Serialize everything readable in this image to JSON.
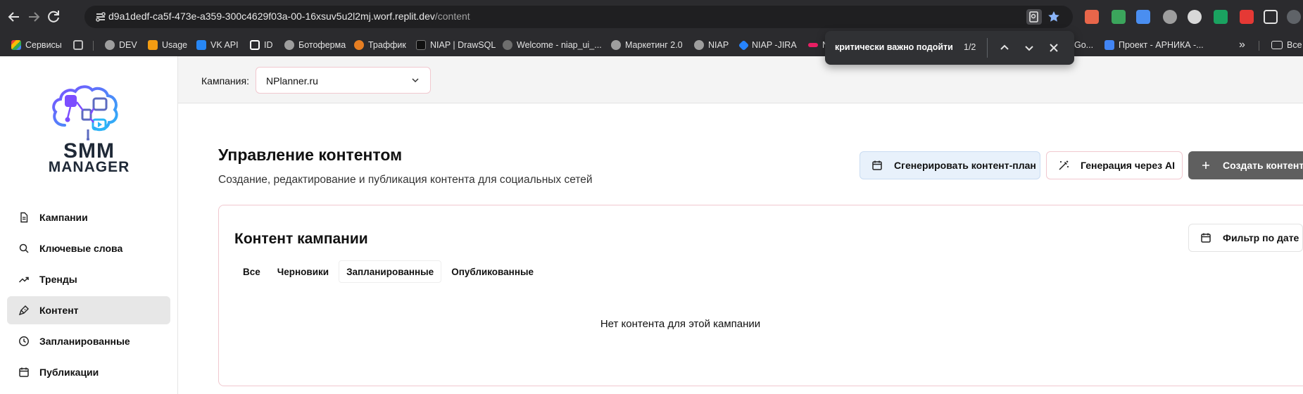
{
  "browser": {
    "url_host": "d9a1dedf-ca5f-473e-a359-300c4629f03a-00-16xsuv5u2l2mj.worf.replit.dev",
    "url_path": "/content",
    "bookmarks": [
      {
        "label": "Сервисы",
        "color": "#e74c3c"
      },
      {
        "label": "DEV",
        "color": "#9e9e9e"
      },
      {
        "label": "Usage",
        "color": "#f39c12"
      },
      {
        "label": "VK API",
        "color": "#2787f5"
      },
      {
        "label": "ID",
        "color": "#ffffff"
      },
      {
        "label": "Ботоферма",
        "color": "#9e9e9e"
      },
      {
        "label": "Траффик",
        "color": "#e67e22"
      },
      {
        "label": "NIAP | DrawSQL",
        "color": "#111111"
      },
      {
        "label": "Welcome - niap_ui_...",
        "color": "#6e6e6e"
      },
      {
        "label": "Маркетинг 2.0",
        "color": "#9e9e9e"
      },
      {
        "label": "NIAP",
        "color": "#9e9e9e"
      },
      {
        "label": "NIAP -JIRA",
        "color": "#2684ff"
      },
      {
        "label": "N",
        "color": "#e91e63"
      },
      {
        "label": "Go...",
        "color": "#4285f4"
      },
      {
        "label": "Проект - АРНИКА -...",
        "color": "#4285f4"
      }
    ],
    "other_bookmarks": "Все закладки",
    "find": {
      "query": "критически важно подойти",
      "count": "1/2"
    }
  },
  "sidebar": {
    "logo_line1": "SMM",
    "logo_line2": "MANAGER",
    "items": [
      {
        "label": "Кампании",
        "icon": "document-icon",
        "active": false
      },
      {
        "label": "Ключевые слова",
        "icon": "search-icon",
        "active": false
      },
      {
        "label": "Тренды",
        "icon": "trending-icon",
        "active": false
      },
      {
        "label": "Контент",
        "icon": "pen-icon",
        "active": true
      },
      {
        "label": "Запланированные",
        "icon": "clock-icon",
        "active": false
      },
      {
        "label": "Публикации",
        "icon": "calendar-icon",
        "active": false
      }
    ]
  },
  "topbar": {
    "campaign_label": "Кампания:",
    "campaign_value": "NPlanner.ru"
  },
  "main": {
    "title": "Управление контентом",
    "subtitle": "Создание, редактирование и публикация контента для социальных сетей",
    "btn_generate_plan": "Сгенерировать контент-план",
    "btn_ai": "Генерация через AI",
    "btn_create": "Создать контент",
    "card": {
      "title": "Контент кампании",
      "filter_label": "Фильтр по дате",
      "tabs": [
        "Все",
        "Черновики",
        "Запланированные",
        "Опубликованные"
      ],
      "selected_tab": 2,
      "empty_text": "Нет контента для этой кампании"
    }
  },
  "colors": {
    "accent_border": "#f1c8cf",
    "plan_button_bg": "#e8f1fb",
    "create_button_bg": "#5f5f5f",
    "active_nav_bg": "#e7e7e7"
  }
}
